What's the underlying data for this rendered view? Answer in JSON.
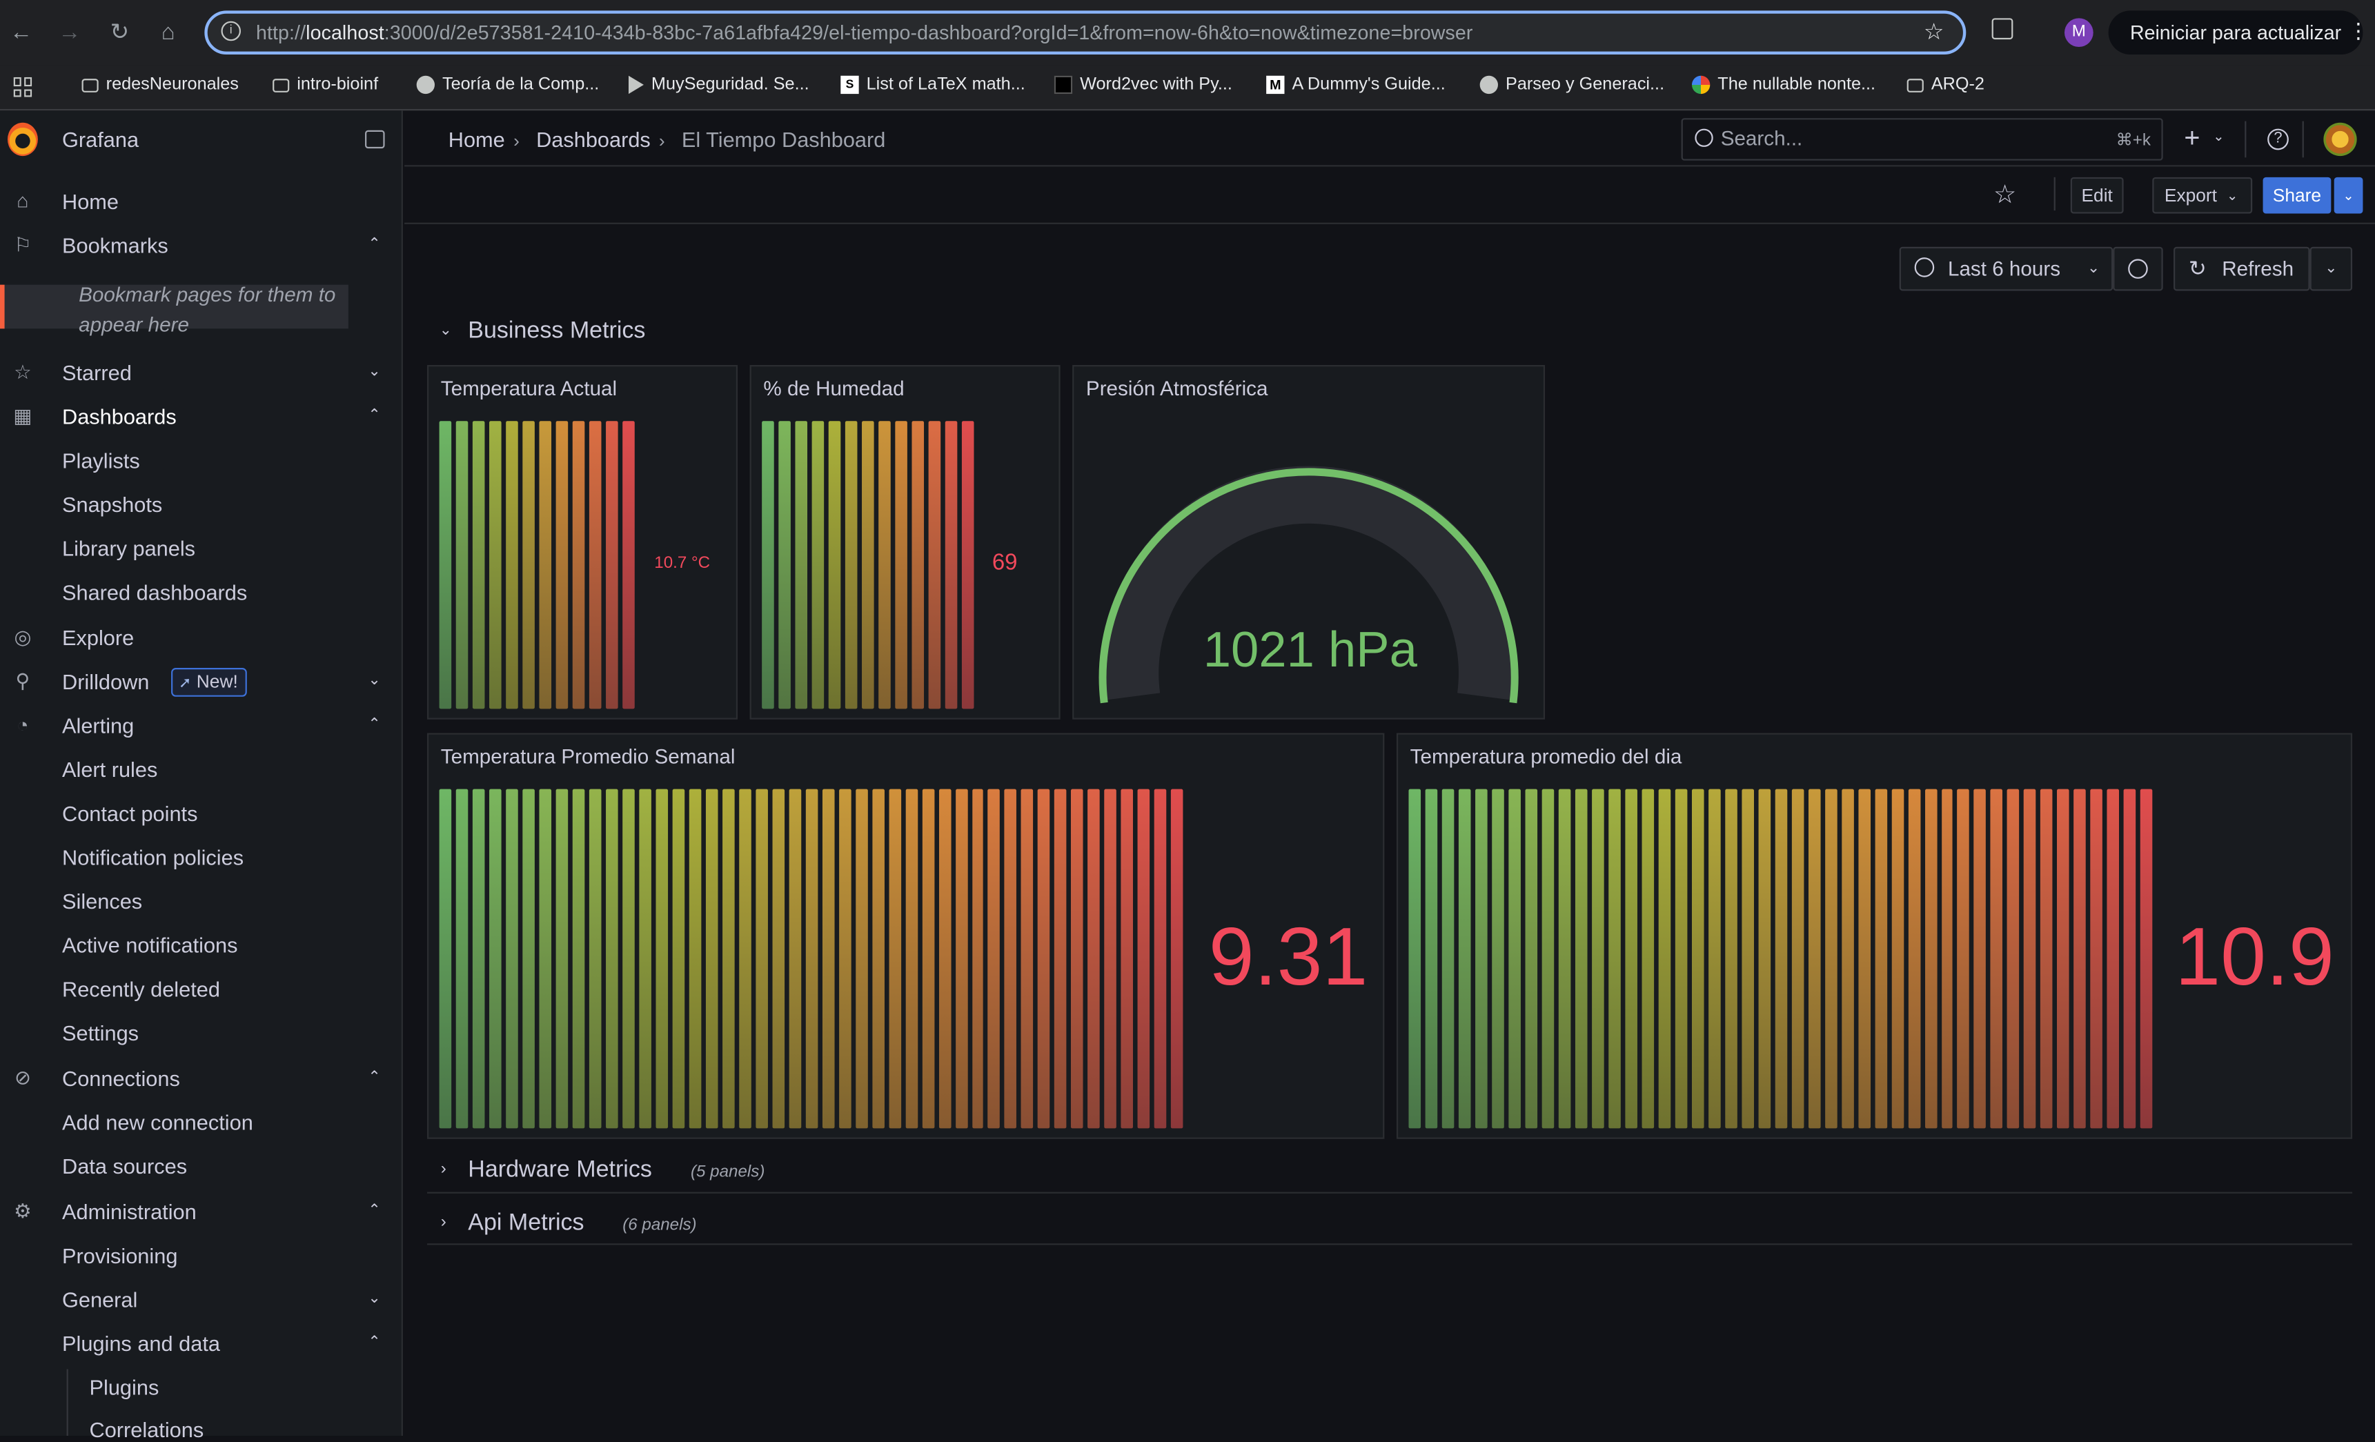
{
  "browser": {
    "url_host_prefix": "http://",
    "url_host": "localhost",
    "url_rest": ":3000/d/2e573581-2410-434b-83bc-7a61afbfa429/el-tiempo-dashboard?orgId=1&from=now-6h&to=now&timezone=browser",
    "profile_initial": "M",
    "relaunch_label": "Reiniciar para actualizar",
    "bookmarks": [
      "redesNeuronales",
      "intro-bioinf",
      "Teoría de la Comp...",
      "MuySeguridad. Se...",
      "List of LaTeX math...",
      "Word2vec with Py...",
      "A Dummy's Guide...",
      "Parseo y Generaci...",
      "The nullable nonte...",
      "ARQ-2"
    ]
  },
  "app": {
    "name": "Grafana"
  },
  "sidebar": {
    "home": "Home",
    "bookmarks": "Bookmarks",
    "bookmarks_hint": "Bookmark pages for them to appear here",
    "starred": "Starred",
    "dashboards": "Dashboards",
    "dashboards_children": [
      "Playlists",
      "Snapshots",
      "Library panels",
      "Shared dashboards"
    ],
    "explore": "Explore",
    "drilldown": "Drilldown",
    "new_badge": "New!",
    "alerting": "Alerting",
    "alerting_children": [
      "Alert rules",
      "Contact points",
      "Notification policies",
      "Silences",
      "Active notifications",
      "Recently deleted",
      "Settings"
    ],
    "connections": "Connections",
    "connections_children": [
      "Add new connection",
      "Data sources"
    ],
    "administration": "Administration",
    "administration_children": [
      "Provisioning",
      "General",
      "Plugins and data"
    ],
    "plugins_children": [
      "Plugins",
      "Correlations"
    ]
  },
  "breadcrumb": [
    "Home",
    "Dashboards",
    "El Tiempo Dashboard"
  ],
  "search": {
    "placeholder": "Search...",
    "shortcut": "⌘+k"
  },
  "toolbar": {
    "edit": "Edit",
    "export": "Export",
    "share": "Share",
    "time_range": "Last 6 hours",
    "refresh": "Refresh"
  },
  "rows": {
    "business": "Business Metrics",
    "hardware": "Hardware Metrics",
    "hardware_count": "(5 panels)",
    "api": "Api Metrics",
    "api_count": "(6 panels)"
  },
  "panels": {
    "temp_actual": {
      "title": "Temperatura Actual",
      "value": "10.7 °C",
      "bars": 12
    },
    "humedad": {
      "title": "% de Humedad",
      "value": "69",
      "bars": 13
    },
    "presion": {
      "title": "Presión Atmosférica",
      "value": "1021 hPa"
    },
    "temp_semanal": {
      "title": "Temperatura Promedio Semanal",
      "value": "9.31",
      "bars": 45
    },
    "temp_dia": {
      "title": "Temperatura promedio del dia",
      "value": "10.9",
      "bars": 45
    }
  },
  "colors": {
    "green": "#73bf69",
    "red": "#f2495c",
    "brand": "#f55f3e",
    "primary": "#3d71d9"
  }
}
